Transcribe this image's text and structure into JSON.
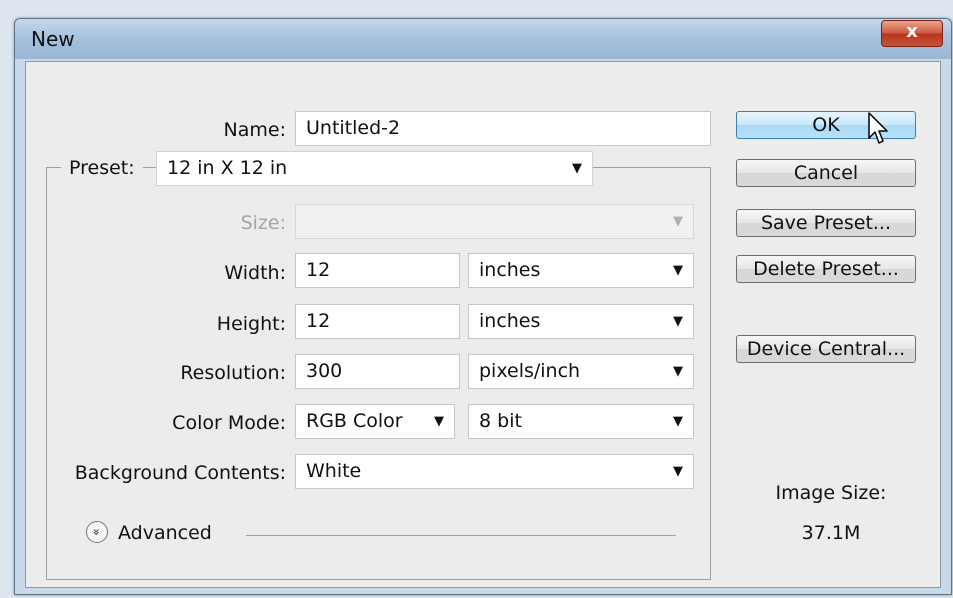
{
  "window": {
    "title": "New",
    "close_glyph": "x"
  },
  "form": {
    "name": {
      "label": "Name:",
      "value": "Untitled-2"
    },
    "preset": {
      "label": "Preset:",
      "value": "12 in X 12 in"
    },
    "size": {
      "label": "Size:",
      "value": ""
    },
    "width": {
      "label": "Width:",
      "value": "12",
      "unit": "inches"
    },
    "height": {
      "label": "Height:",
      "value": "12",
      "unit": "inches"
    },
    "resolution": {
      "label": "Resolution:",
      "value": "300",
      "unit": "pixels/inch"
    },
    "color_mode": {
      "label": "Color Mode:",
      "value": "RGB Color",
      "depth": "8 bit"
    },
    "background": {
      "label": "Background Contents:",
      "value": "White"
    },
    "advanced": {
      "label": "Advanced"
    }
  },
  "buttons": {
    "ok": "OK",
    "cancel": "Cancel",
    "save_preset": "Save Preset...",
    "delete_preset": "Delete Preset...",
    "device_central": "Device Central..."
  },
  "image_size": {
    "label": "Image Size:",
    "value": "37.1M"
  },
  "icons": {
    "dropdown_caret": "▼",
    "advanced_toggle": "»",
    "close": "x",
    "cursor": "arrow-cursor"
  },
  "colors": {
    "ok_border": "#3c7fb1",
    "close_button": "#c6533b",
    "dialog_bg": "#ececec"
  }
}
